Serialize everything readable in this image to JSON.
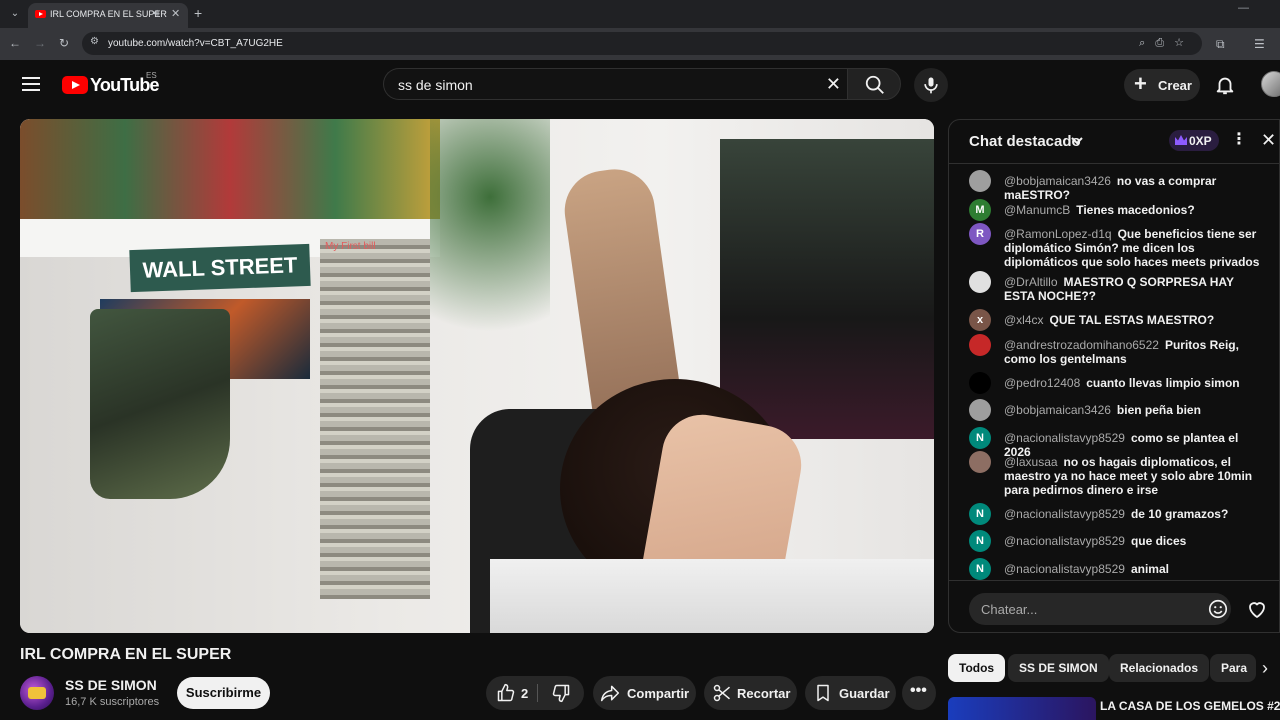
{
  "browser": {
    "tab_title": "IRL COMPRA EN EL SUPER",
    "url": "youtube.com/watch?v=CBT_A7UG2HE"
  },
  "header": {
    "logo_text": "YouTube",
    "country_code": "ES",
    "search_value": "ss de simon",
    "create_label": "Crear"
  },
  "video": {
    "title": "IRL COMPRA EN EL SUPER",
    "channel_name": "SS DE SIMON",
    "subscribers": "16,7 K suscriptores",
    "subscribe_label": "Suscribirme",
    "like_count": "2",
    "share_label": "Compartir",
    "clip_label": "Recortar",
    "save_label": "Guardar",
    "scene_sign": "WALL STREET",
    "scene_box_label": "My First bill"
  },
  "chat": {
    "title": "Chat destacado",
    "xp_label": "0XP",
    "input_placeholder": "Chatear...",
    "messages": [
      {
        "author": "@bobjamaican3426",
        "text": "no vas a comprar maESTRO?",
        "avatar_letter": "",
        "avatar_color": "#9e9e9e"
      },
      {
        "author": "@ManumcB",
        "text": "Tienes macedonios?",
        "avatar_letter": "M",
        "avatar_color": "#2e7d32"
      },
      {
        "author": "@RamonLopez-d1q",
        "text": "Que beneficios tiene ser diplomático Simón? me dicen los diplomáticos que solo haces meets privados",
        "avatar_letter": "R",
        "avatar_color": "#7e57c2"
      },
      {
        "author": "@DrAltillo",
        "text": "MAESTRO Q SORPRESA HAY ESTA NOCHE??",
        "avatar_letter": "",
        "avatar_color": "#e0e0e0"
      },
      {
        "author": "@xl4cx",
        "text": "QUE TAL ESTAS MAESTRO?",
        "avatar_letter": "x",
        "avatar_color": "#795548"
      },
      {
        "author": "@andrestrozadomihano6522",
        "text": "Puritos Reig, como los gentelmans",
        "avatar_letter": "",
        "avatar_color": "#c62828"
      },
      {
        "author": "@pedro12408",
        "text": "cuanto llevas limpio simon",
        "avatar_letter": "",
        "avatar_color": "#000000"
      },
      {
        "author": "@bobjamaican3426",
        "text": "bien peña bien",
        "avatar_letter": "",
        "avatar_color": "#9e9e9e"
      },
      {
        "author": "@nacionalistavyp8529",
        "text": "como se plantea el 2026",
        "avatar_letter": "N",
        "avatar_color": "#00897b"
      },
      {
        "author": "@laxusaa",
        "text": "no os hagais diplomaticos, el maestro ya no hace meet y solo abre 10min para pedirnos dinero e irse",
        "avatar_letter": "",
        "avatar_color": "#8d6e63"
      },
      {
        "author": "@nacionalistavyp8529",
        "text": "de 10 gramazos?",
        "avatar_letter": "N",
        "avatar_color": "#00897b"
      },
      {
        "author": "@nacionalistavyp8529",
        "text": "que dices",
        "avatar_letter": "N",
        "avatar_color": "#00897b"
      },
      {
        "author": "@nacionalistavyp8529",
        "text": "animal",
        "avatar_letter": "N",
        "avatar_color": "#00897b"
      }
    ]
  },
  "chips": [
    "Todos",
    "SS DE SIMON",
    "Relacionados",
    "Para"
  ],
  "recommended": {
    "title": "LA CASA DE LOS GEMELOS #2 |"
  },
  "colors": {
    "background": "#0f0f0f",
    "brand_red": "#ff0000",
    "surface": "#272727",
    "accent_purple": "#8e5bff"
  }
}
